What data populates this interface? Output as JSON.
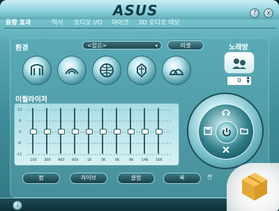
{
  "window": {
    "brand": "ASUS",
    "controls": [
      "?",
      "x"
    ]
  },
  "tabs": [
    {
      "label": "음향 효과",
      "active": true
    },
    {
      "label": "믹서",
      "active": false
    },
    {
      "label": "오디오 I/O",
      "active": false
    },
    {
      "label": "마이크",
      "active": false
    },
    {
      "label": "3D 오디오 데모",
      "active": false
    }
  ],
  "environment": {
    "label": "환경",
    "dropdown_value": "<없음>",
    "reset_button": "리셋",
    "buttons": [
      {
        "icon": "stage-icon"
      },
      {
        "icon": "tunnel-icon"
      },
      {
        "icon": "globe-icon"
      },
      {
        "icon": "knight-icon"
      },
      {
        "icon": "opera-house-icon"
      }
    ]
  },
  "karaoke": {
    "title": "노래방",
    "value": "0"
  },
  "equalizer": {
    "title": "이퀄라이저",
    "db_labels": [
      "12",
      "6",
      "0",
      "-6",
      "-12"
    ],
    "freq_labels": [
      "100",
      "200",
      "400",
      "600",
      "1K",
      "3K",
      "6K",
      "9K",
      "14K",
      "16K"
    ],
    "levels": [
      0,
      0,
      0,
      0,
      0,
      0,
      0,
      0,
      0,
      0
    ]
  },
  "presets": [
    "팝",
    "라이브",
    "클럽",
    "록",
    "잔"
  ],
  "colors": {
    "accent": "#5aa7b3",
    "dark": "#0d2e33",
    "panel": "#468f9a"
  }
}
